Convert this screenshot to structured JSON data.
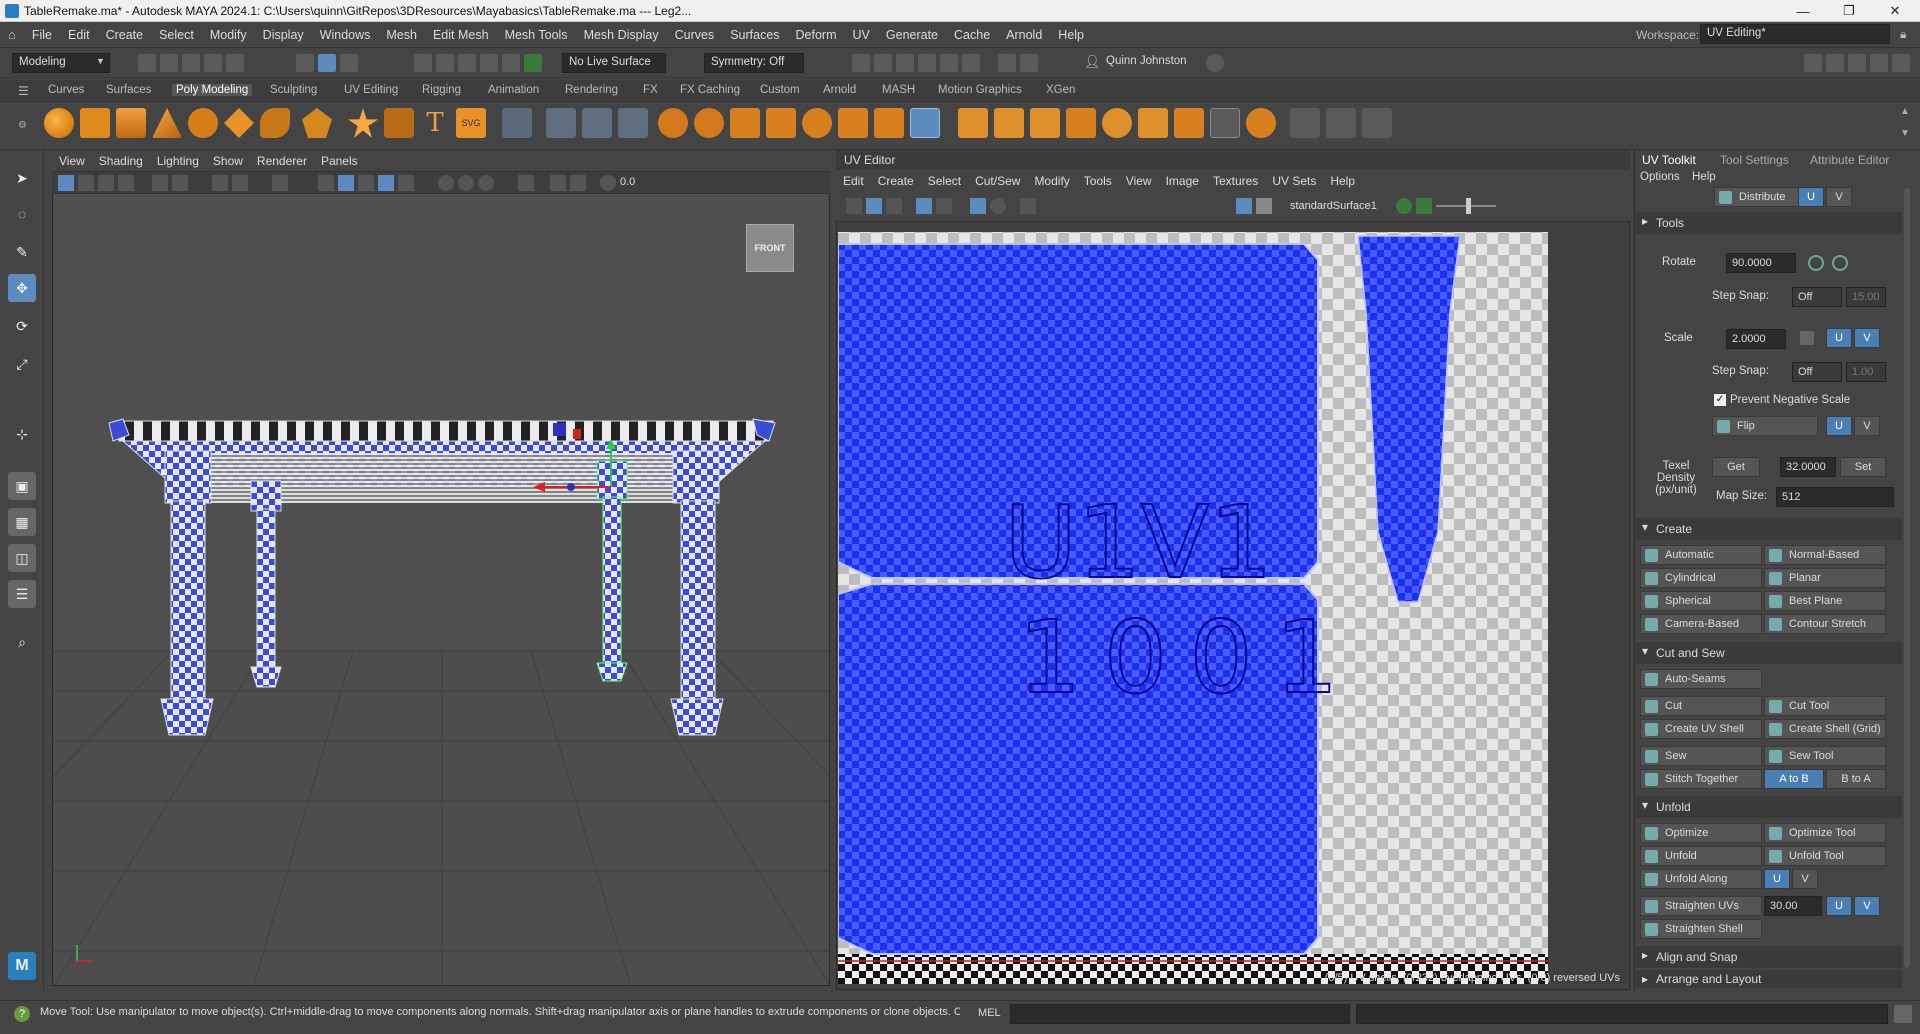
{
  "window": {
    "title": "TableRemake.ma* - Autodesk MAYA 2024.1: C:\\Users\\quinn\\GitRepos\\3DResources\\Mayabasics\\TableRemake.ma   ---   Leg2...",
    "minimize": "—",
    "maximize": "❐",
    "close": "✕"
  },
  "menubar": {
    "items": [
      "File",
      "Edit",
      "Create",
      "Select",
      "Modify",
      "Display",
      "Windows",
      "Mesh",
      "Edit Mesh",
      "Mesh Tools",
      "Mesh Display",
      "Curves",
      "Surfaces",
      "Deform",
      "UV",
      "Generate",
      "Cache",
      "Arnold",
      "Help"
    ],
    "workspace_label": "Workspace:",
    "workspace_value": "UV Editing*"
  },
  "statusline": {
    "menuset": "Modeling",
    "live_surface": "No Live Surface",
    "symmetry": "Symmetry: Off",
    "user": "Quinn Johnston"
  },
  "shelf": {
    "tabs": [
      "Curves",
      "Surfaces",
      "Poly Modeling",
      "Sculpting",
      "UV Editing",
      "Rigging",
      "Animation",
      "Rendering",
      "FX",
      "FX Caching",
      "Custom",
      "Arnold",
      "MASH",
      "Motion Graphics",
      "XGen"
    ],
    "active_tab": "Poly Modeling"
  },
  "viewport": {
    "menu": [
      "View",
      "Shading",
      "Lighting",
      "Show",
      "Renderer",
      "Panels"
    ],
    "view_cube_label": "FRONT",
    "field_value": "0.0"
  },
  "uv_editor": {
    "title": "UV Editor",
    "menu": [
      "Edit",
      "Create",
      "Select",
      "Cut/Sew",
      "Modify",
      "Tools",
      "View",
      "Image",
      "Textures",
      "UV Sets",
      "Help"
    ],
    "shader": "standardSurface1",
    "udim_line1": "U1V1",
    "udim_line2": "1001",
    "status": "(0/5) UV shells, (0/232) overlapping UVs, (0/0) reversed UVs"
  },
  "uv_toolkit": {
    "tabs": [
      "UV Toolkit",
      "Tool Settings",
      "Attribute Editor"
    ],
    "active_tab": "UV Toolkit",
    "menu": [
      "Options",
      "Help"
    ],
    "distribute": "Distribute",
    "u": "U",
    "v": "V",
    "tools_section": "Tools",
    "rotate_label": "Rotate",
    "rotate_value": "90.0000",
    "step_snap_label": "Step Snap:",
    "step_snap_value": "Off",
    "rotate_step": "15.00",
    "scale_label": "Scale",
    "scale_value": "2.0000",
    "scale_step": "1.00",
    "prevent_negative_scale": "Prevent Negative Scale",
    "flip": "Flip",
    "texel_density_label": "Texel Density (px/unit)",
    "get": "Get",
    "texel_value": "32.0000",
    "set": "Set",
    "map_size_label": "Map Size:",
    "map_size_value": "512",
    "create_section": "Create",
    "create_buttons": [
      "Automatic",
      "Normal-Based",
      "Cylindrical",
      "Planar",
      "Spherical",
      "Best Plane",
      "Camera-Based",
      "Contour Stretch"
    ],
    "cut_sew_section": "Cut and Sew",
    "auto_seams": "Auto-Seams",
    "cut_buttons": [
      "Cut",
      "Cut Tool",
      "Create UV Shell",
      "Create Shell (Grid)",
      "Sew",
      "Sew Tool"
    ],
    "stitch_together": "Stitch Together",
    "a_to_b": "A to B",
    "b_to_a": "B to A",
    "unfold_section": "Unfold",
    "unfold_buttons": [
      "Optimize",
      "Optimize Tool",
      "Unfold",
      "Unfold Tool"
    ],
    "unfold_along": "Unfold Along",
    "straighten_uvs": "Straighten UVs",
    "straighten_value": "30.00",
    "straighten_shell": "Straighten Shell",
    "align_snap_section": "Align and Snap",
    "arrange_section": "Arrange and Layout"
  },
  "helpline": {
    "text": "Move Tool: Use manipulator to move object(s). Ctrl+middle-drag to move components along normals. Shift+drag manipulator axis or plane handles to extrude components or clone objects. Ctrl+Shift+drag to c",
    "mel": "MEL"
  }
}
